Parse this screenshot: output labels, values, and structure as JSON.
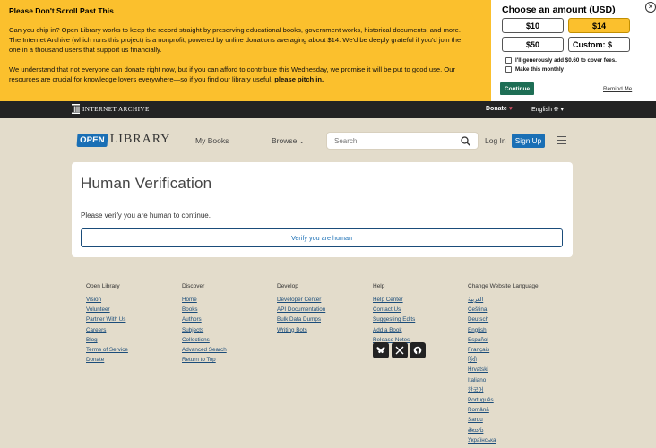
{
  "banner": {
    "heading": "Please Don't Scroll Past This",
    "p1": "Can you chip in? Open Library works to keep the record straight by preserving educational books, government works, historical documents, and more. The Internet Archive (which runs this project) is a nonprofit, powered by online donations averaging about $14. We'd be deeply grateful if you'd join the one in a thousand users that support us financially.",
    "p2": "We understand that not everyone can donate right now, but if you can afford to contribute this Wednesday, we promise it will be put to good use. Our resources are crucial for knowledge lovers everywhere—so if you find our library useful, ",
    "p2_bold": "please pitch in.",
    "amount_title": "Choose an amount (USD)",
    "amounts": [
      "$10",
      "$14",
      "$50"
    ],
    "custom_label": "Custom: $",
    "cover_fees": "I'll generously add $0.60 to cover fees.",
    "monthly": "Make this monthly",
    "continue_label": "Continue",
    "remind_label": "Remind Me",
    "close_label": "×"
  },
  "ia_bar": {
    "logo_text": "INTERNET ARCHIVE",
    "donate": "Donate",
    "heart": "♥",
    "language": "English"
  },
  "header": {
    "logo_open": "OPEN",
    "logo_library": "LIBRARY",
    "my_books": "My Books",
    "browse": "Browse",
    "search_placeholder": "Search",
    "login": "Log In",
    "signup": "Sign Up"
  },
  "card": {
    "title": "Human Verification",
    "message": "Please verify you are human to continue.",
    "button": "Verify you are human"
  },
  "footer": {
    "open_library": {
      "heading": "Open Library",
      "links": [
        "Vision",
        "Volunteer",
        "Partner With Us",
        "Careers",
        "Blog",
        "Terms of Service",
        "Donate"
      ]
    },
    "discover": {
      "heading": "Discover",
      "links": [
        "Home",
        "Books",
        "Authors",
        "Subjects",
        "Collections",
        "Advanced Search",
        "Return to Top"
      ]
    },
    "develop": {
      "heading": "Develop",
      "links": [
        "Developer Center",
        "API Documentation",
        "Bulk Data Dumps",
        "Writing Bots"
      ]
    },
    "help": {
      "heading": "Help",
      "links": [
        "Help Center",
        "Contact Us",
        "Suggesting Edits",
        "Add a Book",
        "Release Notes"
      ]
    },
    "languages": {
      "heading": "Change Website Language",
      "links": [
        "العربية",
        "Čeština",
        "Deutsch",
        "English",
        "Español",
        "Français",
        "हिंदी",
        "Hrvatski",
        "Italiano",
        "한국어",
        "Português",
        "Română",
        "Sardu",
        "తెలుగు",
        "Українська"
      ]
    }
  }
}
